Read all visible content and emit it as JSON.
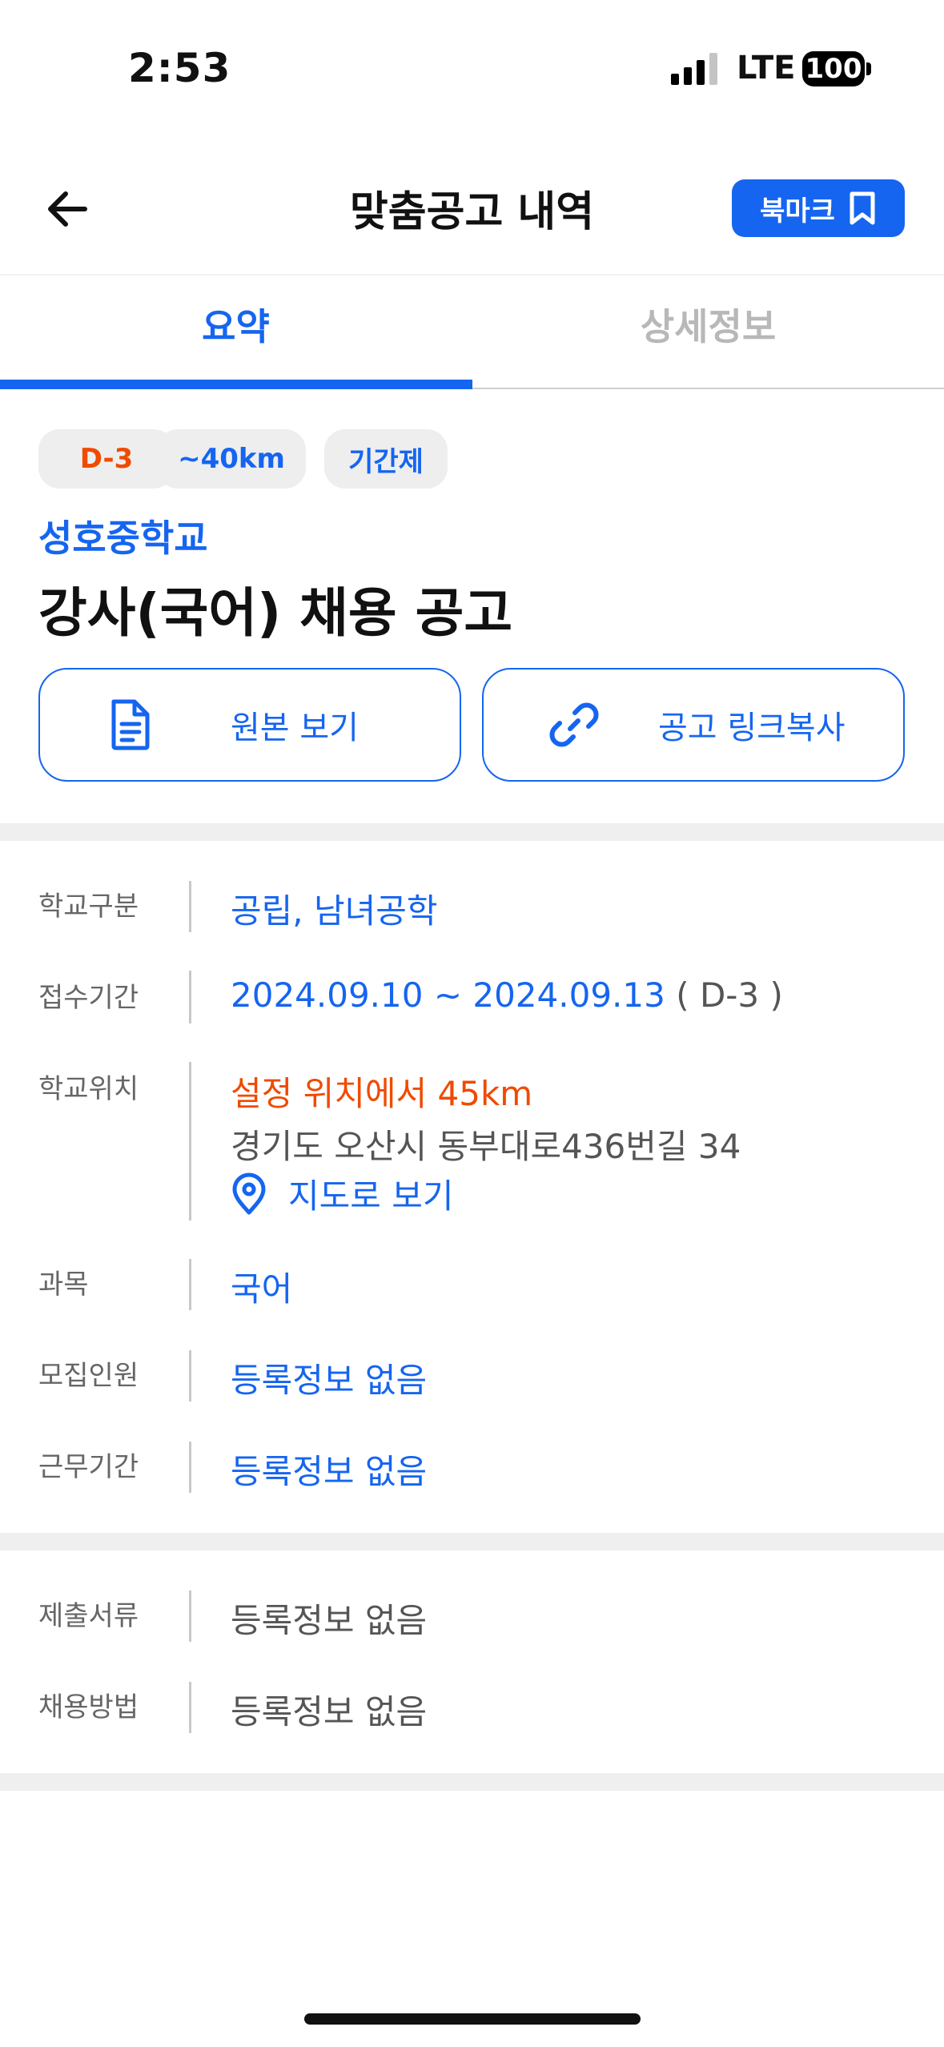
{
  "status_bar": {
    "time": "2:53",
    "network": "LTE",
    "battery": "100"
  },
  "header": {
    "title": "맞춤공고 내역",
    "bookmark_label": "북마크"
  },
  "tabs": [
    {
      "label": "요약",
      "active": true
    },
    {
      "label": "상세정보",
      "active": false
    }
  ],
  "tags": {
    "dday": "D-3",
    "distance": "~40km",
    "type": "기간제"
  },
  "posting": {
    "school": "성호중학교",
    "title": "강사(국어) 채용 공고"
  },
  "actions": {
    "view_original": "원본 보기",
    "copy_link": "공고 링크복사"
  },
  "info": {
    "school_type": {
      "label": "학교구분",
      "value": "공립, 남녀공학"
    },
    "period": {
      "label": "접수기간",
      "value": "2024.09.10 ~ 2024.09.13",
      "dday": "( D-3 )"
    },
    "location": {
      "label": "학교위치",
      "distance": "설정 위치에서 45km",
      "address": "경기도 오산시 동부대로436번길 34",
      "map_link": "지도로 보기"
    },
    "subject": {
      "label": "과목",
      "value": "국어"
    },
    "recruits": {
      "label": "모집인원",
      "value": "등록정보 없음"
    },
    "work_period": {
      "label": "근무기간",
      "value": "등록정보 없음"
    }
  },
  "extra": {
    "documents": {
      "label": "제출서류",
      "value": "등록정보 없음"
    },
    "method": {
      "label": "채용방법",
      "value": "등록정보 없음"
    }
  },
  "colors": {
    "accent": "#1565f0",
    "warning": "#f04a00",
    "label": "#666666",
    "muted": "#b8b8b8"
  }
}
